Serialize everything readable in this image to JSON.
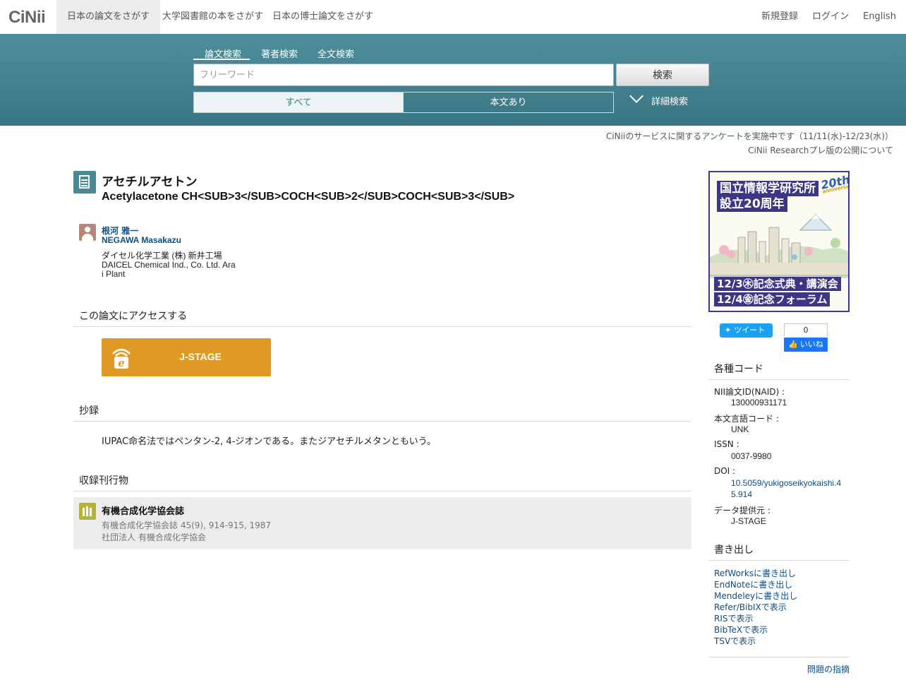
{
  "logo": "CiNii",
  "topnav": {
    "tabs": [
      "日本の論文をさがす",
      "大学図書館の本をさがす",
      "日本の博士論文をさがす"
    ],
    "register": "新規登録",
    "login": "ログイン",
    "language": "English"
  },
  "search": {
    "tabs": [
      "論文検索",
      "著者検索",
      "全文検索"
    ],
    "placeholder": "フリーワード",
    "button": "検索",
    "filter_all": "すべて",
    "filter_body": "本文あり",
    "advanced": "詳細検索"
  },
  "notices": [
    "CiNiiのサービスに関するアンケートを実施中です（11/11(水)-12/23(水)）",
    "CiNii Researchプレ版の公開について"
  ],
  "article": {
    "title_ja": "アセチルアセトン",
    "title_en": "Acetylacetone CH<SUB>3</SUB>COCH<SUB>2</SUB>COCH<SUB>3</SUB>",
    "author_ja": "根河 雅一",
    "author_en": "NEGAWA Masakazu",
    "affil_ja": "ダイセル化学工業 (株) 新井工場",
    "affil_en_1": "DAICEL Chemical Ind., Co. Ltd. Ara",
    "affil_en_2": "i Plant"
  },
  "access": {
    "heading": "この論文にアクセスする",
    "jstage_label": "J-STAGE"
  },
  "abstract": {
    "heading": "抄録",
    "text": "IUPAC命名法ではペンタン-2, 4-ジオンである。またジアセチルメタンともいう。"
  },
  "journal": {
    "heading": "収録刊行物",
    "title": "有機合成化学協会誌",
    "citation": "有機合成化学協会誌 45(9), 914-915, 1987",
    "publisher": "社団法人 有機合成化学協会"
  },
  "banner": {
    "line1": "国立情報学研究所",
    "line2": "設立20周年",
    "badge": "20th",
    "badge_sub": "anniversary",
    "event1": "12/3㊍記念式典・講演会",
    "event2": "12/4㊎記念フォーラム"
  },
  "social": {
    "tweet": "ツイート",
    "like_count": "0",
    "like": "いいね"
  },
  "codes": {
    "heading": "各種コード",
    "naid_label": "NII論文ID(NAID) :",
    "naid": "130000931171",
    "lang_label": "本文言語コード :",
    "lang": "UNK",
    "issn_label": "ISSN :",
    "issn": "0037-9980",
    "doi_label": "DOI :",
    "doi": "10.5059/yukigoseikyokaishi.45.914",
    "provider_label": "データ提供元 :",
    "provider": "J-STAGE"
  },
  "export": {
    "heading": "書き出し",
    "items": [
      "RefWorksに書き出し",
      "EndNoteに書き出し",
      "Mendeleyに書き出し",
      "Refer/BibIXで表示",
      "RISで表示",
      "BibTeXで表示",
      "TSVで表示"
    ]
  },
  "report": "問題の指摘",
  "colors": {
    "band": "#437f8c",
    "jstage": "#df9a24",
    "link": "#0b4f8a"
  }
}
